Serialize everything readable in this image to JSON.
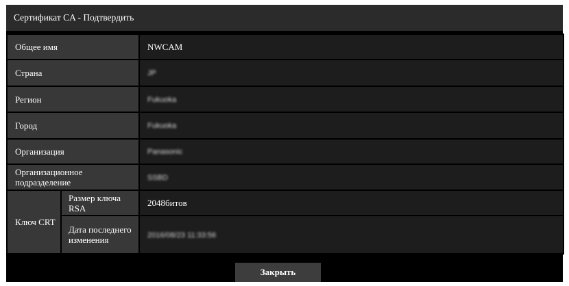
{
  "dialog": {
    "title": "Сертификат CA - Подтвердить",
    "close_label": "Закрыть"
  },
  "rows": [
    {
      "label": "Общее имя",
      "value": "NWCAM",
      "obscured": false
    },
    {
      "label": "Страна",
      "value": "JP",
      "obscured": true
    },
    {
      "label": "Регион",
      "value": "Fukuoka",
      "obscured": true
    },
    {
      "label": "Город",
      "value": "Fukuoka",
      "obscured": true
    },
    {
      "label": "Организация",
      "value": "Panasonic",
      "obscured": true
    },
    {
      "label": "Организационное подразделение",
      "value": "SSBD",
      "obscured": true
    }
  ],
  "crt_key": {
    "label": "Ключ CRT",
    "rsa_size_label": "Размер ключа RSA",
    "rsa_size_value": "2048битов",
    "last_modified_label": "Дата последнего изменения",
    "last_modified_value": "2016/08/23 11:33:56"
  }
}
